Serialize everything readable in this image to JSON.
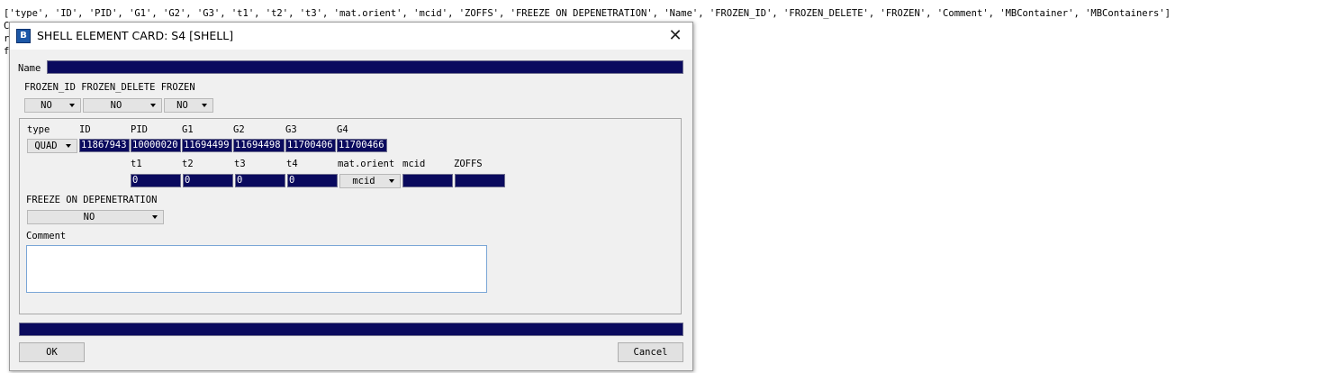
{
  "console": {
    "line1": "['type', 'ID', 'PID', 'G1', 'G2', 'G3', 't1', 't2', 't3', 'mat.orient', 'mcid', 'ZOFFS', 'FREEZE ON DEPENETRATION', 'Name', 'FROZEN_ID', 'FROZEN_DELETE', 'FROZEN', 'Comment', 'MBContainer', 'MBContainers']",
    "line2": "C",
    "line3": "r",
    "line4": "f"
  },
  "dialog": {
    "title": "SHELL ELEMENT CARD: S4 [SHELL]",
    "icon_glyph": "B",
    "close_glyph": "✕",
    "name_label": "Name",
    "name_value": "",
    "frozen": {
      "header": "FROZEN_ID FROZEN_DELETE FROZEN",
      "frozen_id": "NO",
      "frozen_delete": "NO",
      "frozen": "NO"
    },
    "element": {
      "headers": [
        "type",
        "ID",
        "PID",
        "G1",
        "G2",
        "G3",
        "G4"
      ],
      "type": "QUAD",
      "id": "11867943",
      "pid": "10000020",
      "g1": "11694499",
      "g2": "11694498",
      "g3": "11700406",
      "g4": "11700466"
    },
    "thickness": {
      "headers": [
        "t1",
        "t2",
        "t3",
        "t4",
        "mat.orient",
        "mcid",
        "ZOFFS"
      ],
      "t1": "0",
      "t2": "0",
      "t3": "0",
      "t4": "0",
      "mat_orient": "mcid",
      "mcid": "",
      "zoffs": ""
    },
    "freeze": {
      "label": "FREEZE ON DEPENETRATION",
      "value": "NO"
    },
    "comment": {
      "label": "Comment",
      "value": ""
    },
    "status_value": "",
    "ok_label": "OK",
    "cancel_label": "Cancel"
  }
}
